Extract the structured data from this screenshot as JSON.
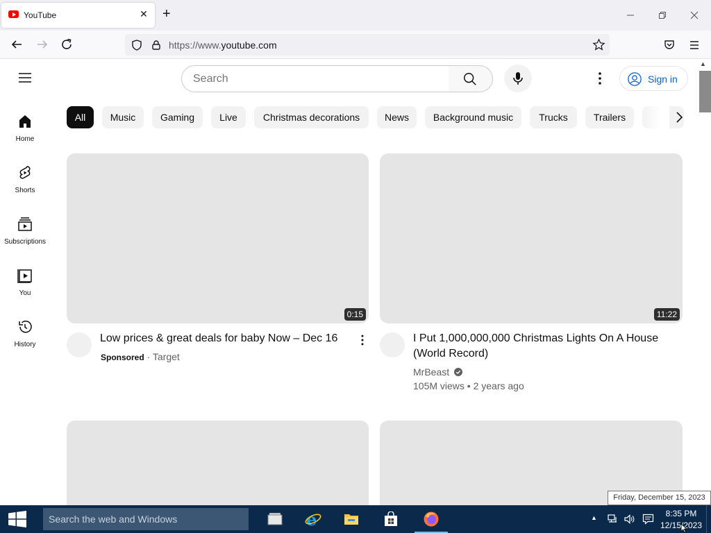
{
  "browser": {
    "tab_title": "YouTube",
    "url_prefix": "https://www.",
    "url_domain": "youtube.com"
  },
  "youtube": {
    "search_placeholder": "Search",
    "sign_in_label": "Sign in",
    "sidebar": [
      {
        "label": "Home",
        "icon": "home-icon"
      },
      {
        "label": "Shorts",
        "icon": "shorts-icon"
      },
      {
        "label": "Subscriptions",
        "icon": "subscriptions-icon"
      },
      {
        "label": "You",
        "icon": "you-icon"
      },
      {
        "label": "History",
        "icon": "history-icon"
      }
    ],
    "chips": [
      "All",
      "Music",
      "Gaming",
      "Live",
      "Christmas decorations",
      "News",
      "Background music",
      "Trucks",
      "Trailers"
    ],
    "videos": [
      {
        "duration": "0:15",
        "title": "Low prices & great deals for baby Now – Dec 16",
        "sponsored_label": "Sponsored",
        "separator": "·",
        "channel": "Target"
      },
      {
        "duration": "11:22",
        "title": "I Put 1,000,000,000 Christmas Lights On A House (World Record)",
        "channel": "MrBeast",
        "stats": "105M views • 2 years ago"
      }
    ]
  },
  "taskbar": {
    "search_placeholder": "Search the web and Windows",
    "time": "8:35 PM",
    "date": "12/15/2023",
    "tooltip": "Friday, December 15, 2023"
  },
  "colors": {
    "youtube_red": "#ff0000",
    "sign_in_blue": "#065fd4",
    "taskbar_bg": "#0b2a4b"
  }
}
